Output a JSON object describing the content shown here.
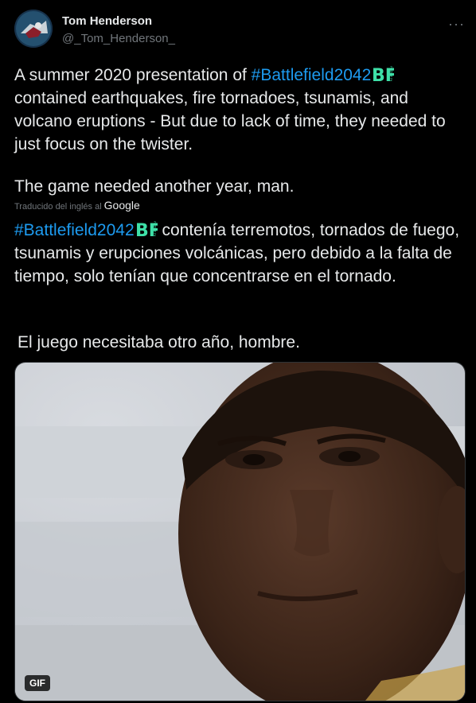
{
  "author": {
    "name": "Tom Henderson",
    "handle": "@_Tom_Henderson_"
  },
  "more_icon": "more-horizontal-icon",
  "tweet": {
    "hashtag": "#Battlefield2042",
    "en_line1_prefix": "A summer 2020 presentation of ",
    "en_rest": "contained earthquakes, fire tornadoes, tsunamis, and volcano eruptions - But due to lack of time, they needed to just focus on the twister.",
    "en_para2": "The game needed another year, man.",
    "translated_label": "Traducido del inglés al",
    "translated_brand": "Google",
    "es_rest": " contenía terremotos, tornados de fuego, tsunamis y erupciones volcánicas, pero debido a la falta de tiempo, solo tenían que concentrarse en el tornado.",
    "es_para2": "El juego necesitaba otro año, hombre."
  },
  "media": {
    "badge": "GIF"
  },
  "colors": {
    "background": "#000000",
    "text": "#e7e9ea",
    "link": "#1d9bf0",
    "secondary": "#71767b",
    "bf_badge": "#3ee0a8"
  }
}
